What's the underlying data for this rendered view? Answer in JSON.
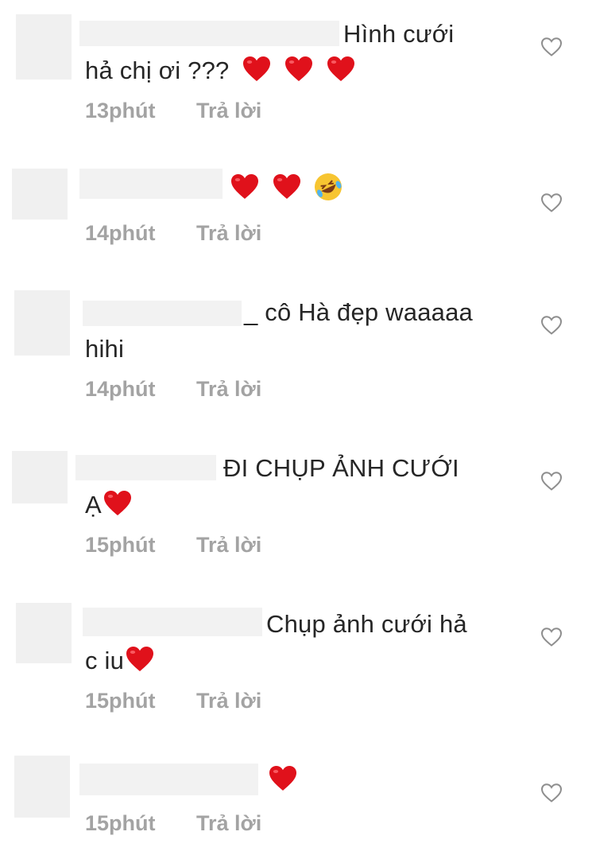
{
  "comments": [
    {
      "line1": "Hình cưới",
      "line2": "hả chị ơi ???",
      "time": "13phút",
      "reply": "Trả lời"
    },
    {
      "line1": ".",
      "time": "14phút",
      "reply": "Trả lời"
    },
    {
      "line1": "_ cô Hà đẹp waaaaa",
      "line2": "hihi",
      "time": "14phút",
      "reply": "Trả lời"
    },
    {
      "line1": "ĐI CHỤP ẢNH CƯỚI",
      "line2": "Ạ",
      "time": "15phút",
      "reply": "Trả lời"
    },
    {
      "line1": "Chụp ảnh cưới hả",
      "line2": "c iu",
      "time": "15phút",
      "reply": "Trả lời"
    },
    {
      "line1": "",
      "time": "15phút",
      "reply": "Trả lời"
    }
  ],
  "icons": {
    "like": "heart-outline-icon",
    "emoji_heart": "red-heart-emoji",
    "emoji_laugh": "rolling-laughing-emoji"
  },
  "colors": {
    "heart": "#e0111b",
    "meta": "#a3a3a3",
    "text": "#262626"
  }
}
